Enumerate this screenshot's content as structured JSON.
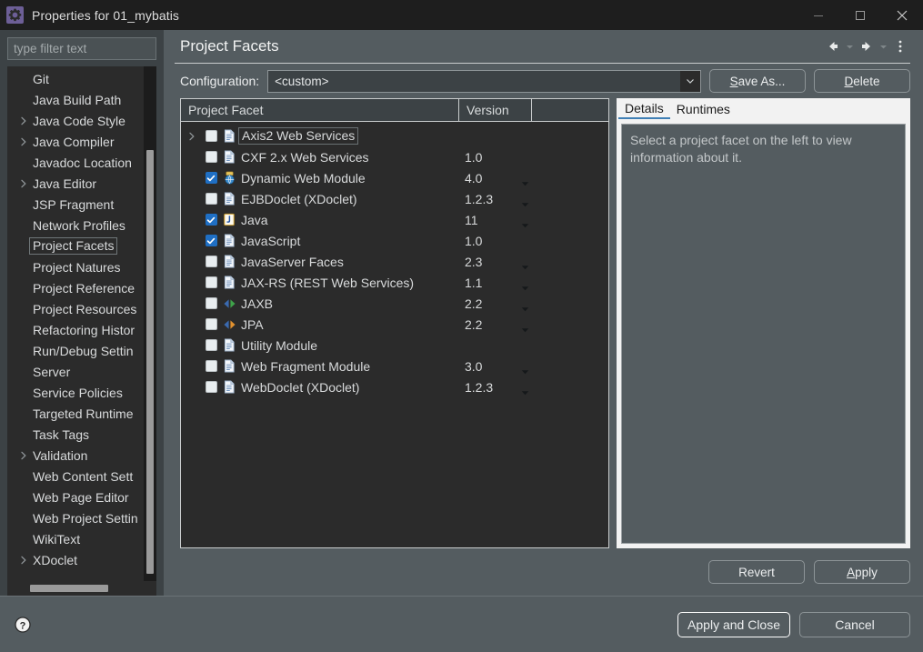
{
  "window": {
    "title": "Properties for 01_mybatis",
    "icon": "properties-gear-icon",
    "minimize_label": "Minimize",
    "maximize_label": "Maximize",
    "close_label": "Close"
  },
  "sidebar": {
    "filter_placeholder": "type filter text",
    "filter_value": "",
    "items": [
      {
        "label": "Git",
        "expandable": false,
        "selected": false
      },
      {
        "label": "Java Build Path",
        "expandable": false,
        "selected": false
      },
      {
        "label": "Java Code Style",
        "expandable": true,
        "selected": false
      },
      {
        "label": "Java Compiler",
        "expandable": true,
        "selected": false
      },
      {
        "label": "Javadoc Location",
        "expandable": false,
        "selected": false
      },
      {
        "label": "Java Editor",
        "expandable": true,
        "selected": false
      },
      {
        "label": "JSP Fragment",
        "expandable": false,
        "selected": false
      },
      {
        "label": "Network Profiles",
        "expandable": false,
        "selected": false
      },
      {
        "label": "Project Facets",
        "expandable": false,
        "selected": true
      },
      {
        "label": "Project Natures",
        "expandable": false,
        "selected": false
      },
      {
        "label": "Project Reference",
        "expandable": false,
        "selected": false
      },
      {
        "label": "Project Resources",
        "expandable": false,
        "selected": false
      },
      {
        "label": "Refactoring Histor",
        "expandable": false,
        "selected": false
      },
      {
        "label": "Run/Debug Settin",
        "expandable": false,
        "selected": false
      },
      {
        "label": "Server",
        "expandable": false,
        "selected": false
      },
      {
        "label": "Service Policies",
        "expandable": false,
        "selected": false
      },
      {
        "label": "Targeted Runtime",
        "expandable": false,
        "selected": false
      },
      {
        "label": "Task Tags",
        "expandable": false,
        "selected": false
      },
      {
        "label": "Validation",
        "expandable": true,
        "selected": false
      },
      {
        "label": "Web Content Sett",
        "expandable": false,
        "selected": false
      },
      {
        "label": "Web Page Editor",
        "expandable": false,
        "selected": false
      },
      {
        "label": "Web Project Settin",
        "expandable": false,
        "selected": false
      },
      {
        "label": "WikiText",
        "expandable": false,
        "selected": false
      },
      {
        "label": "XDoclet",
        "expandable": true,
        "selected": false
      }
    ]
  },
  "page": {
    "title": "Project Facets",
    "nav": {
      "back_label": "Back",
      "forward_label": "Forward",
      "menu_label": "View Menu"
    }
  },
  "configuration": {
    "label": "Configuration:",
    "value": "<custom>",
    "save_as_label": "Save As...",
    "save_as_mnemonic": "S",
    "delete_label": "Delete",
    "delete_mnemonic": "D"
  },
  "facet_table": {
    "columns": [
      "Project Facet",
      "Version",
      ""
    ],
    "rows": [
      {
        "name": "Axis2 Web Services",
        "version": "",
        "checked": false,
        "expandable": true,
        "focused": true,
        "has_version_dropdown": false,
        "icon": "document-icon"
      },
      {
        "name": "CXF 2.x Web Services",
        "version": "1.0",
        "checked": false,
        "expandable": false,
        "focused": false,
        "has_version_dropdown": false,
        "icon": "document-icon"
      },
      {
        "name": "Dynamic Web Module",
        "version": "4.0",
        "checked": true,
        "expandable": false,
        "focused": false,
        "has_version_dropdown": true,
        "icon": "web-module-icon"
      },
      {
        "name": "EJBDoclet (XDoclet)",
        "version": "1.2.3",
        "checked": false,
        "expandable": false,
        "focused": false,
        "has_version_dropdown": true,
        "icon": "document-icon"
      },
      {
        "name": "Java",
        "version": "11",
        "checked": true,
        "expandable": false,
        "focused": false,
        "has_version_dropdown": true,
        "icon": "java-icon"
      },
      {
        "name": "JavaScript",
        "version": "1.0",
        "checked": true,
        "expandable": false,
        "focused": false,
        "has_version_dropdown": false,
        "icon": "document-icon"
      },
      {
        "name": "JavaServer Faces",
        "version": "2.3",
        "checked": false,
        "expandable": false,
        "focused": false,
        "has_version_dropdown": true,
        "icon": "document-icon"
      },
      {
        "name": "JAX-RS (REST Web Services)",
        "version": "1.1",
        "checked": false,
        "expandable": false,
        "focused": false,
        "has_version_dropdown": true,
        "icon": "document-icon"
      },
      {
        "name": "JAXB",
        "version": "2.2",
        "checked": false,
        "expandable": false,
        "focused": false,
        "has_version_dropdown": true,
        "icon": "jaxb-icon"
      },
      {
        "name": "JPA",
        "version": "2.2",
        "checked": false,
        "expandable": false,
        "focused": false,
        "has_version_dropdown": true,
        "icon": "jpa-icon"
      },
      {
        "name": "Utility Module",
        "version": "",
        "checked": false,
        "expandable": false,
        "focused": false,
        "has_version_dropdown": false,
        "icon": "document-icon"
      },
      {
        "name": "Web Fragment Module",
        "version": "3.0",
        "checked": false,
        "expandable": false,
        "focused": false,
        "has_version_dropdown": true,
        "icon": "document-icon"
      },
      {
        "name": "WebDoclet (XDoclet)",
        "version": "1.2.3",
        "checked": false,
        "expandable": false,
        "focused": false,
        "has_version_dropdown": true,
        "icon": "document-icon"
      }
    ]
  },
  "details_panel": {
    "tabs": [
      {
        "label": "Details",
        "active": true
      },
      {
        "label": "Runtimes",
        "active": false
      }
    ],
    "message": "Select a project facet on the left to view information about it."
  },
  "apply_row": {
    "revert_label": "Revert",
    "apply_label": "Apply",
    "apply_mnemonic": "A"
  },
  "bottom_bar": {
    "help_label": "Help",
    "apply_and_close_label": "Apply and Close",
    "cancel_label": "Cancel"
  },
  "colors": {
    "window_bg": "#545c60",
    "titlebar_bg": "#1e1e1e",
    "tree_bg": "#2b2b2b",
    "sidebar_bg": "#3c4245",
    "checkbox_on": "#1f6fc4",
    "tab_bg": "#f2f2f2",
    "text_primary": "#d8dadb",
    "border_light": "#c9cccd"
  }
}
